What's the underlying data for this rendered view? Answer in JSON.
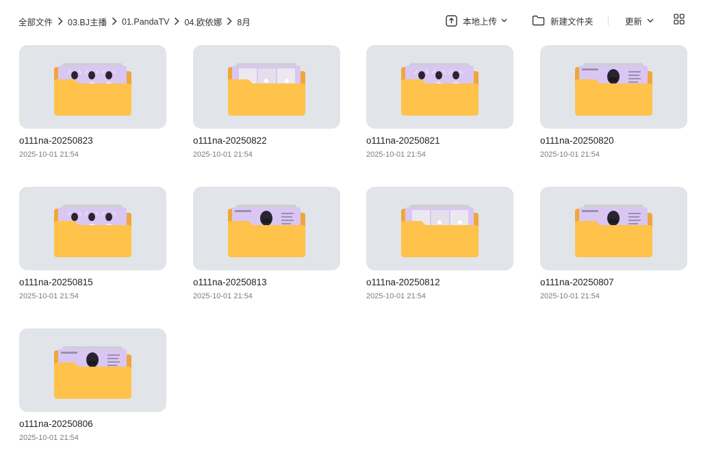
{
  "breadcrumb": [
    "全部文件",
    "03.BJ主播",
    "01.PandaTV",
    "04.欧依娜",
    "8月"
  ],
  "toolbar": {
    "upload_label": "本地上传",
    "new_folder_label": "新建文件夹",
    "sort_label": "更新",
    "icons": {
      "upload": "upload-icon",
      "new_folder": "folder-outline-icon",
      "sort": "chevron-down-icon",
      "grid": "grid-view-icon"
    }
  },
  "colors": {
    "card_bg": "#e1e4e8",
    "folder_front": "#ffc24b",
    "folder_back": "#f0a63a",
    "preview_bg": "#d9c6f2"
  },
  "folders": [
    {
      "name": "o111na-20250823",
      "date": "2025-10-01 21:54",
      "preview": "three-people"
    },
    {
      "name": "o111na-20250822",
      "date": "2025-10-01 21:54",
      "preview": "empty-room"
    },
    {
      "name": "o111na-20250821",
      "date": "2025-10-01 21:54",
      "preview": "three-people"
    },
    {
      "name": "o111na-20250820",
      "date": "2025-10-01 21:54",
      "preview": "single-masked"
    },
    {
      "name": "o111na-20250815",
      "date": "2025-10-01 21:54",
      "preview": "three-people"
    },
    {
      "name": "o111na-20250813",
      "date": "2025-10-01 21:54",
      "preview": "single-masked"
    },
    {
      "name": "o111na-20250812",
      "date": "2025-10-01 21:54",
      "preview": "empty-room"
    },
    {
      "name": "o111na-20250807",
      "date": "2025-10-01 21:54",
      "preview": "single-masked"
    },
    {
      "name": "o111na-20250806",
      "date": "2025-10-01 21:54",
      "preview": "single-masked"
    }
  ]
}
